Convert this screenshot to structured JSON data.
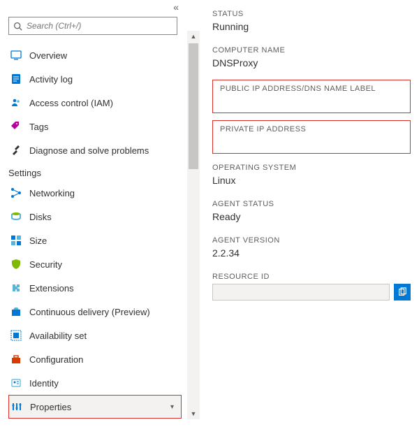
{
  "search": {
    "placeholder": "Search (Ctrl+/)"
  },
  "nav": {
    "top": [
      {
        "label": "Overview"
      },
      {
        "label": "Activity log"
      },
      {
        "label": "Access control (IAM)"
      },
      {
        "label": "Tags"
      },
      {
        "label": "Diagnose and solve problems"
      }
    ],
    "section_settings": "Settings",
    "settings": [
      {
        "label": "Networking"
      },
      {
        "label": "Disks"
      },
      {
        "label": "Size"
      },
      {
        "label": "Security"
      },
      {
        "label": "Extensions"
      },
      {
        "label": "Continuous delivery (Preview)"
      },
      {
        "label": "Availability set"
      },
      {
        "label": "Configuration"
      },
      {
        "label": "Identity"
      },
      {
        "label": "Properties"
      }
    ]
  },
  "details": {
    "status": {
      "label": "STATUS",
      "value": "Running"
    },
    "computer_name": {
      "label": "COMPUTER NAME",
      "value": "DNSProxy"
    },
    "public_ip": {
      "label": "PUBLIC IP ADDRESS/DNS NAME LABEL",
      "value": ""
    },
    "private_ip": {
      "label": "PRIVATE IP ADDRESS",
      "value": ""
    },
    "os": {
      "label": "OPERATING SYSTEM",
      "value": "Linux"
    },
    "agent_status": {
      "label": "AGENT STATUS",
      "value": "Ready"
    },
    "agent_version": {
      "label": "AGENT VERSION",
      "value": "2.2.34"
    },
    "resource_id": {
      "label": "RESOURCE ID",
      "value": ""
    }
  }
}
